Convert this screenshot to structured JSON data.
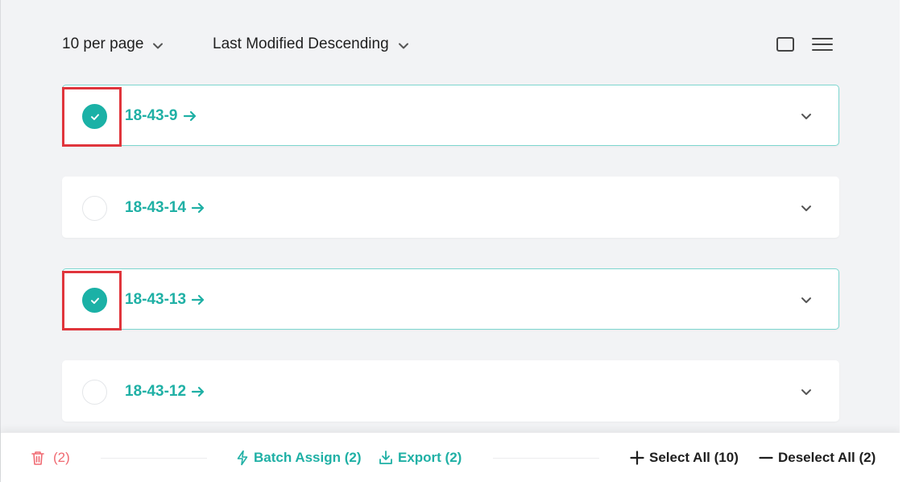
{
  "toolbar": {
    "per_page_label": "10 per page",
    "sort_label": "Last Modified Descending"
  },
  "cards": [
    {
      "title": "18-43-9",
      "selected": true
    },
    {
      "title": "18-43-14",
      "selected": false
    },
    {
      "title": "18-43-13",
      "selected": true
    },
    {
      "title": "18-43-12",
      "selected": false
    }
  ],
  "footer": {
    "delete_count": "(2)",
    "batch_assign_label": "Batch Assign (2)",
    "export_label": "Export (2)",
    "select_all_label": "Select All (10)",
    "deselect_all_label": "Deselect All (2)"
  },
  "colors": {
    "accent": "#1bb1a6",
    "accent_text": "#1fb0a5",
    "danger": "#f06a72",
    "highlight": "#e0353c",
    "background": "#f2f3f5"
  }
}
